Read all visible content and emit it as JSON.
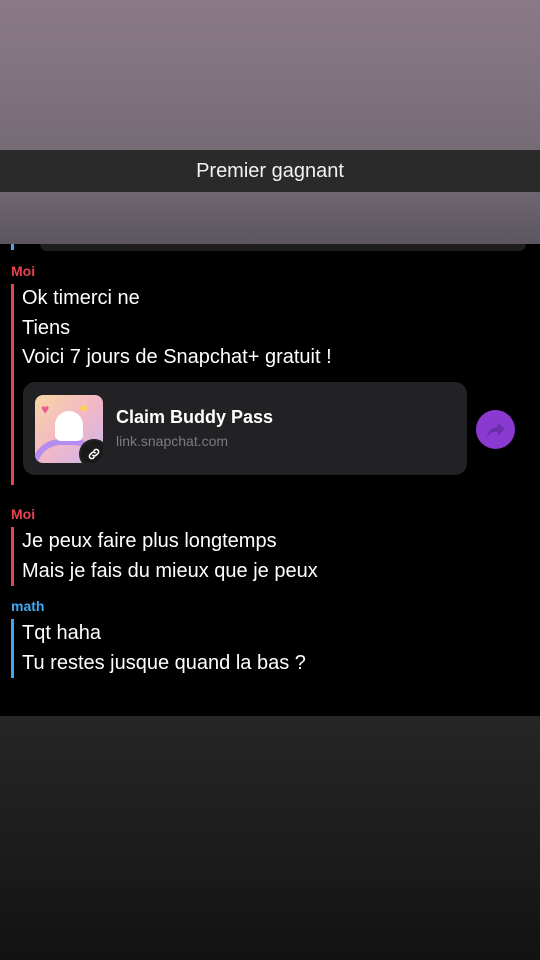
{
  "caption": "Premier gagnant",
  "messages": [
    {
      "sender": "Moi",
      "lines": [
        "Ok timerci ne",
        "Tiens",
        "Voici 7 jours de Snapchat+ gratuit !"
      ],
      "link": {
        "title": "Claim Buddy Pass",
        "url": "link.snapchat.com"
      }
    },
    {
      "sender": "Moi",
      "lines": [
        "Je peux faire plus longtemps",
        "Mais je fais du mieux que je peux"
      ]
    },
    {
      "sender": "math",
      "lines": [
        "Tqt haha",
        "Tu restes jusque quand la bas ?"
      ]
    }
  ],
  "colors": {
    "me": "#e6454f",
    "friend": "#3fa9f5",
    "share_button": "#8a3ad1"
  },
  "icons": {
    "link_badge": "link-icon",
    "share": "share-arrow-icon"
  }
}
